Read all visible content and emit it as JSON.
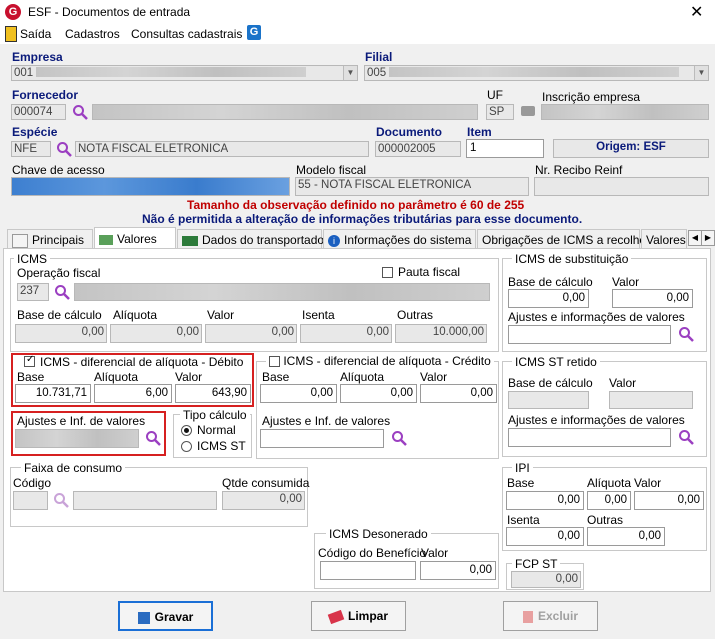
{
  "window": {
    "title": "ESF - Documentos de entrada",
    "close_glyph": "✕",
    "app_icon_letter": "G"
  },
  "menu": {
    "items": [
      "Saída",
      "Cadastros",
      "Consultas cadastrais"
    ],
    "g_icon": "G"
  },
  "header": {
    "empresa_label": "Empresa",
    "empresa_value": "001",
    "filial_label": "Filial",
    "filial_value": "005",
    "fornecedor_label": "Fornecedor",
    "fornecedor_value": "000074",
    "uf_label": "UF",
    "uf_value": "SP",
    "inscricao_label": "Inscrição empresa",
    "especie_label": "Espécie",
    "especie_value": "NFE",
    "especie_desc": "NOTA FISCAL ELETRONICA",
    "documento_label": "Documento",
    "documento_value": "000002005",
    "item_label": "Item",
    "item_value": "1",
    "origem": "Origem: ESF",
    "chave_label": "Chave de acesso",
    "modelo_label": "Modelo fiscal",
    "modelo_value": "55 - NOTA FISCAL ELETRONICA",
    "recibo_label": "Nr. Recibo Reinf",
    "warning1": "Tamanho da observação definido no parâmetro é 60 de 255",
    "warning2": "Não é permitida a alteração de informações tributárias para esse documento."
  },
  "tabs": [
    "Principais",
    "Valores",
    "Dados do transportador",
    "Informações do sistema",
    "Obrigações de ICMS a recolher",
    "Valores"
  ],
  "icms": {
    "title": "ICMS",
    "operacao_label": "Operação fiscal",
    "operacao_value": "237",
    "pauta_label": "Pauta fiscal",
    "base_label": "Base de cálculo",
    "aliquota_label": "Alíquota",
    "valor_label": "Valor",
    "isenta_label": "Isenta",
    "outras_label": "Outras",
    "base_value": "0,00",
    "aliquota_value": "0,00",
    "valor_value": "0,00",
    "isenta_value": "0,00",
    "outras_value": "10.000,00"
  },
  "difal_debito": {
    "title": "ICMS - diferencial de alíquota - Débito",
    "base_label": "Base",
    "aliquota_label": "Alíquota",
    "valor_label": "Valor",
    "base_value": "10.731,71",
    "aliquota_value": "6,00",
    "valor_value": "643,90",
    "ajustes_label": "Ajustes e Inf. de valores",
    "tipo_title": "Tipo cálculo",
    "tipo_normal": "Normal",
    "tipo_st": "ICMS ST"
  },
  "difal_credito": {
    "title": "ICMS - diferencial de alíquota - Crédito",
    "base_label": "Base",
    "aliquota_label": "Alíquota",
    "valor_label": "Valor",
    "base_value": "0,00",
    "aliquota_value": "0,00",
    "valor_value": "0,00",
    "ajustes_label": "Ajustes e Inf. de valores"
  },
  "icms_sub": {
    "title": "ICMS de substituição",
    "base_label": "Base de cálculo",
    "valor_label": "Valor",
    "base_value": "0,00",
    "valor_value": "0,00",
    "ajustes_label": "Ajustes e informações de valores"
  },
  "icms_st_retido": {
    "title": "ICMS ST retido",
    "base_label": "Base de cálculo",
    "valor_label": "Valor",
    "ajustes_label": "Ajustes e informações de valores"
  },
  "faixa": {
    "title": "Faixa de consumo",
    "codigo_label": "Código",
    "qtde_label": "Qtde consumida",
    "qtde_value": "0,00"
  },
  "ipi": {
    "title": "IPI",
    "base_label": "Base",
    "aliquota_label": "Alíquota",
    "valor_label": "Valor",
    "base_value": "0,00",
    "aliquota_value": "0,00",
    "valor_value": "0,00",
    "isenta_label": "Isenta",
    "outras_label": "Outras",
    "isenta_value": "0,00",
    "outras_value": "0,00"
  },
  "icms_desonerado": {
    "title": "ICMS Desonerado",
    "codigo_label": "Código do Benefício",
    "valor_label": "Valor",
    "valor_value": "0,00"
  },
  "fcp_st": {
    "title": "FCP ST",
    "value": "0,00"
  },
  "buttons": {
    "gravar": "Gravar",
    "limpar": "Limpar",
    "excluir": "Excluir"
  },
  "colors": {
    "accent": "#1a6fd6",
    "warning": "#c00000",
    "label_blue": "#0a1a7a",
    "highlight_box": "#d62020"
  }
}
